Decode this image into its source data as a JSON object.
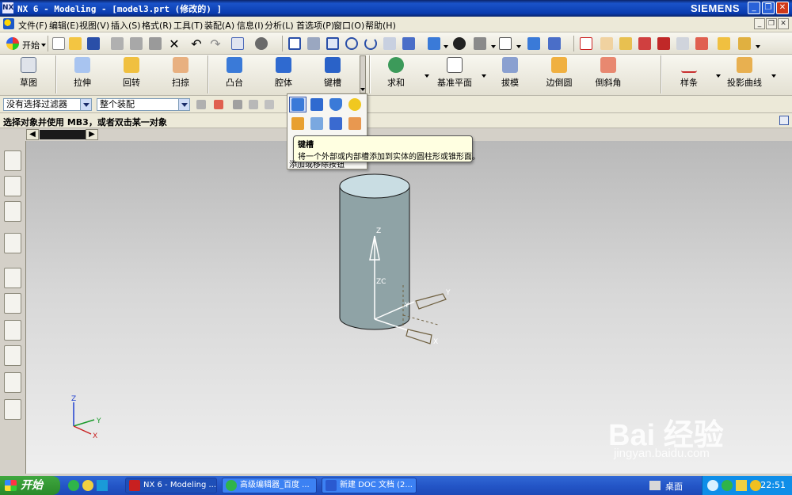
{
  "window": {
    "title": "NX 6 - Modeling - [model3.prt (修改的) ]",
    "brand": "SIEMENS",
    "minimize": "_",
    "restore": "❐",
    "close": "✕"
  },
  "menu": {
    "items": [
      "文件(F)",
      "编辑(E)",
      "视图(V)",
      "插入(S)",
      "格式(R)",
      "工具(T)",
      "装配(A)",
      "信息(I)",
      "分析(L)",
      "首选项(P)",
      "窗口(O)",
      "帮助(H)"
    ]
  },
  "standard_toolbar": {
    "start_label": "开始"
  },
  "feature_toolbar": {
    "buttons": [
      "草图",
      "拉伸",
      "回转",
      "扫掠",
      "凸台",
      "腔体",
      "键槽",
      "求和",
      "基准平面",
      "拔模",
      "边倒圆",
      "倒斜角",
      "样条",
      "投影曲线"
    ]
  },
  "selection_bar": {
    "filter_value": "没有选择过滤器",
    "scope_value": "整个装配"
  },
  "status": {
    "prompt": "选择对象并使用 MB3，或者双击某一对象"
  },
  "gallery_popup": {
    "hint_text": "添加或移除按钮"
  },
  "tooltip": {
    "title": "键槽",
    "description": "将一个外部或内部槽添加到实体的圆柱形或锥形面。"
  },
  "triad": {
    "z": "Z",
    "zc": "ZC",
    "y": "Y",
    "x": "X",
    "yc": "Y"
  },
  "mini_triad": {
    "z": "Z",
    "y": "Y",
    "x": "X"
  },
  "taskbar": {
    "start": "开始",
    "tasks": [
      "NX 6 - Modeling ...",
      "高级编辑器_百度 ...",
      "新建 DOC 文档 (2..."
    ],
    "desktop_label": "桌面",
    "clock": "22:51"
  },
  "watermark": {
    "logo": "Bai 经验",
    "url": "jingyan.baidu.com"
  },
  "colors": {
    "title_bar": "#0a246a",
    "cylinder_side": "#8fa3a6",
    "cylinder_top": "#c9dde3",
    "axis_color": "#6f6040",
    "taskbar": "#2456c7"
  }
}
